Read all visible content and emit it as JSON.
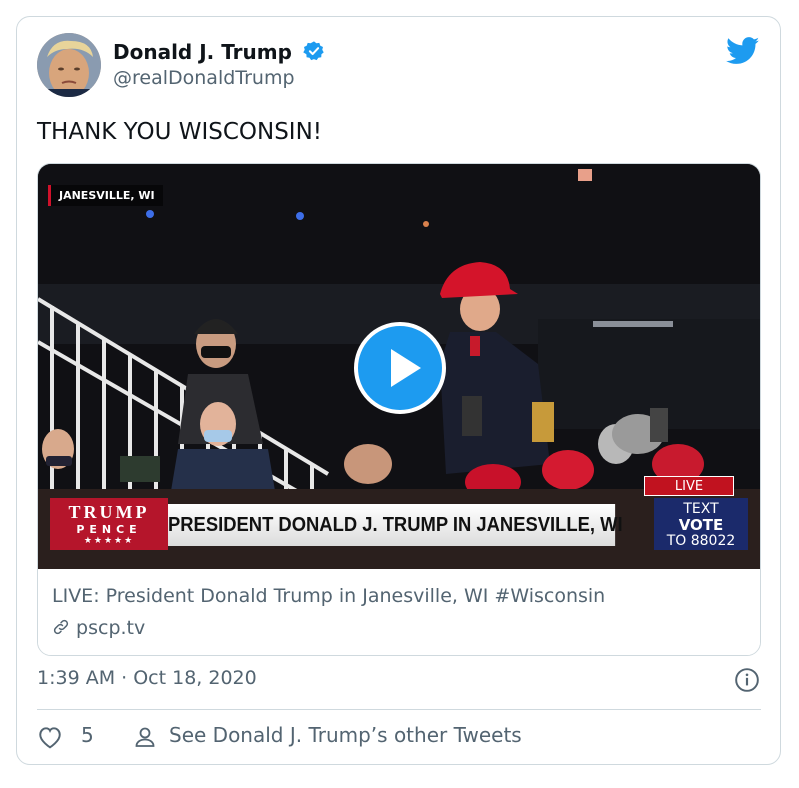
{
  "tweet": {
    "author_name": "Donald J. Trump",
    "handle": "@realDonaldTrump",
    "text": "THANK YOU WISCONSIN!",
    "timestamp": "1:39 AM · Oct 18, 2020",
    "likes": "5",
    "other_tweets_label": "See Donald J. Trump’s other Tweets"
  },
  "media": {
    "location_badge": "JANESVILLE, WI",
    "logo_top": "TRUMP",
    "logo_bottom": "PENCE",
    "logo_stars": "★★★★★",
    "banner": "PRESIDENT DONALD J. TRUMP IN JANESVILLE, WI",
    "live_tag": "LIVE",
    "vote_line1": "TEXT",
    "vote_line2": "VOTE",
    "vote_line3": "TO 88022",
    "card_title": "LIVE: President Donald Trump in Janesville, WI #Wisconsin",
    "card_domain": "pscp.tv"
  },
  "colors": {
    "twitter_blue": "#1d9bf0",
    "muted_text": "#536471",
    "border": "#cfd9de"
  },
  "icons": [
    "verified-badge-icon",
    "twitter-bird-icon",
    "play-icon",
    "link-icon",
    "info-icon",
    "heart-icon",
    "user-icon"
  ]
}
